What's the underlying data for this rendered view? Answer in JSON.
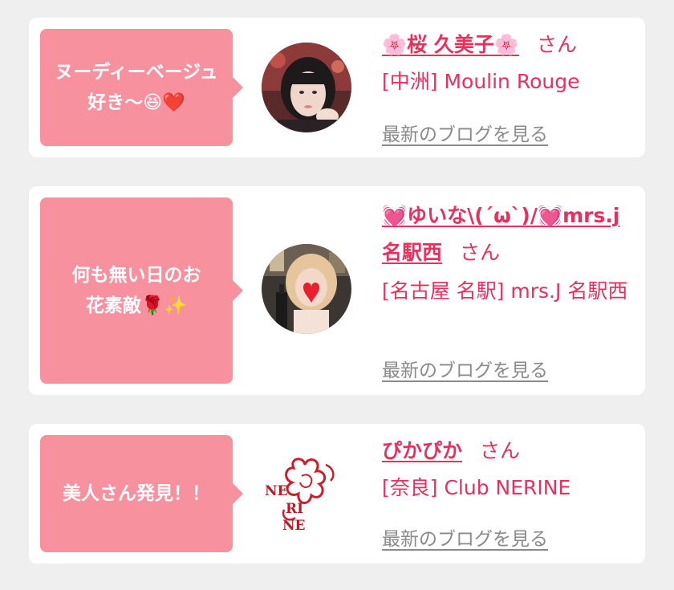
{
  "cards": [
    {
      "comment": "ヌーディーベージュ好き〜😆❤️",
      "name": "🌸桜 久美子🌸",
      "san": "さん",
      "shop": "[中洲] Moulin Rouge",
      "blog_link": "最新のブログを見る",
      "avatar": "woman-avatar-1"
    },
    {
      "comment": "何も無い日のお花素敵🌹✨",
      "name": "💓ゆいな\\(´ω`)/💓mrs.j名駅西",
      "san": "さん",
      "shop": "[名古屋 名駅] mrs.J 名駅西",
      "blog_link": "最新のブログを見る",
      "avatar": "woman-avatar-2"
    },
    {
      "comment": "美人さん発見！！",
      "name": "ぴかぴか",
      "san": "さん",
      "shop": "[奈良] Club NERINE",
      "blog_link": "最新のブログを見る",
      "avatar": "nerine-logo",
      "logo_text": "NERINE"
    }
  ],
  "colors": {
    "accent": "#e8305e",
    "bubble": "#f7919e",
    "link_gray": "#8a8a8a",
    "background": "#efefef"
  }
}
